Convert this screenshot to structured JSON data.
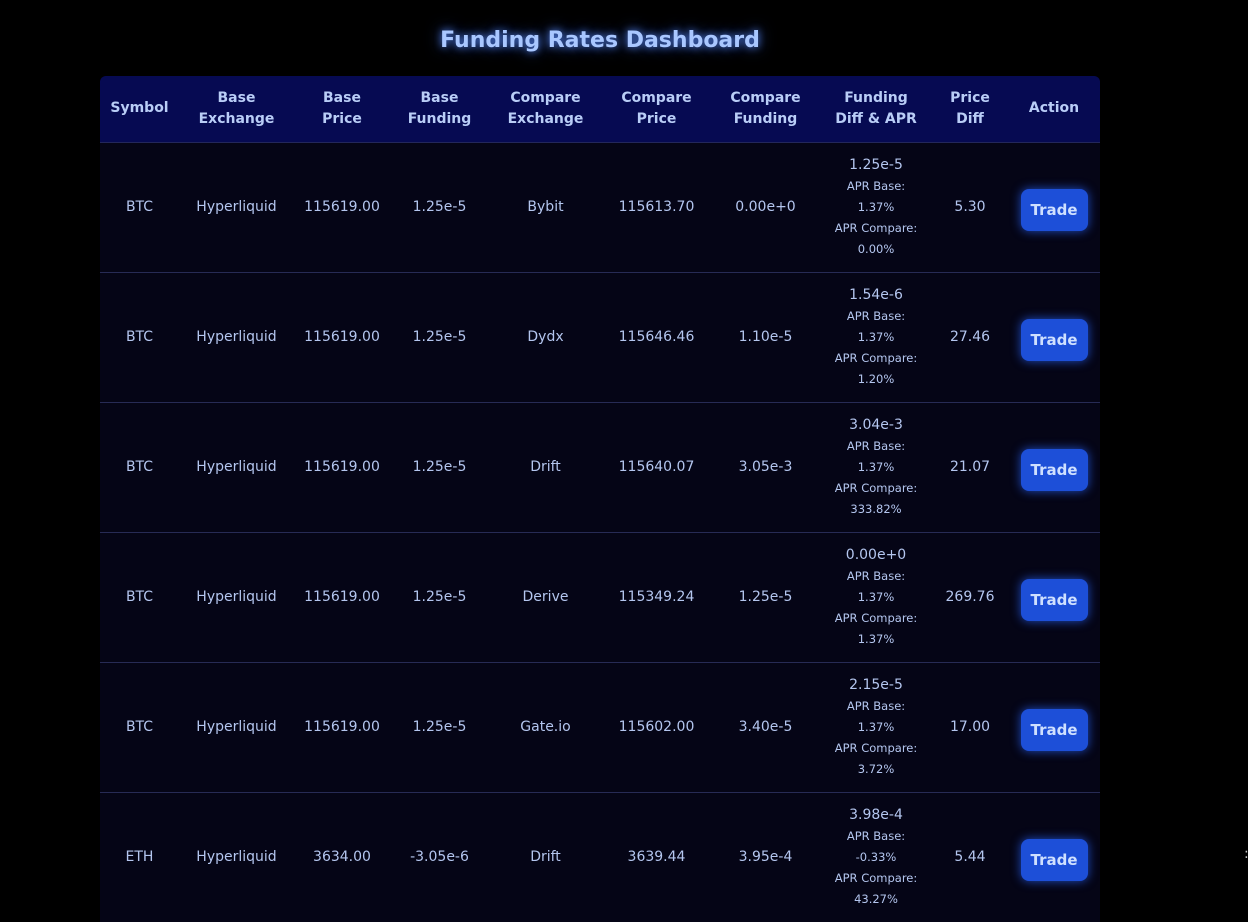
{
  "page": {
    "title": "Funding Rates Dashboard"
  },
  "table": {
    "headers": [
      {
        "line1": "Symbol",
        "line2": ""
      },
      {
        "line1": "Base",
        "line2": "Exchange"
      },
      {
        "line1": "Base",
        "line2": "Price"
      },
      {
        "line1": "Base",
        "line2": "Funding"
      },
      {
        "line1": "Compare",
        "line2": "Exchange"
      },
      {
        "line1": "Compare",
        "line2": "Price"
      },
      {
        "line1": "Compare",
        "line2": "Funding"
      },
      {
        "line1": "Funding",
        "line2": "Diff & APR"
      },
      {
        "line1": "Price",
        "line2": "Diff"
      },
      {
        "line1": "Action",
        "line2": ""
      }
    ],
    "rows": [
      {
        "symbol": "BTC",
        "base_exchange": "Hyperliquid",
        "base_price": "115619.00",
        "base_funding": "1.25e-5",
        "compare_exchange": "Bybit",
        "compare_price": "115613.70",
        "compare_funding": "0.00e+0",
        "funding_diff": "1.25e-5",
        "apr_base_label": "APR Base:",
        "apr_base": "1.37%",
        "apr_compare_label": "APR Compare:",
        "apr_compare": "0.00%",
        "price_diff": "5.30",
        "action": "Trade"
      },
      {
        "symbol": "BTC",
        "base_exchange": "Hyperliquid",
        "base_price": "115619.00",
        "base_funding": "1.25e-5",
        "compare_exchange": "Dydx",
        "compare_price": "115646.46",
        "compare_funding": "1.10e-5",
        "funding_diff": "1.54e-6",
        "apr_base_label": "APR Base:",
        "apr_base": "1.37%",
        "apr_compare_label": "APR Compare:",
        "apr_compare": "1.20%",
        "price_diff": "27.46",
        "action": "Trade"
      },
      {
        "symbol": "BTC",
        "base_exchange": "Hyperliquid",
        "base_price": "115619.00",
        "base_funding": "1.25e-5",
        "compare_exchange": "Drift",
        "compare_price": "115640.07",
        "compare_funding": "3.05e-3",
        "funding_diff": "3.04e-3",
        "apr_base_label": "APR Base:",
        "apr_base": "1.37%",
        "apr_compare_label": "APR Compare:",
        "apr_compare": "333.82%",
        "price_diff": "21.07",
        "action": "Trade"
      },
      {
        "symbol": "BTC",
        "base_exchange": "Hyperliquid",
        "base_price": "115619.00",
        "base_funding": "1.25e-5",
        "compare_exchange": "Derive",
        "compare_price": "115349.24",
        "compare_funding": "1.25e-5",
        "funding_diff": "0.00e+0",
        "apr_base_label": "APR Base:",
        "apr_base": "1.37%",
        "apr_compare_label": "APR Compare:",
        "apr_compare": "1.37%",
        "price_diff": "269.76",
        "action": "Trade"
      },
      {
        "symbol": "BTC",
        "base_exchange": "Hyperliquid",
        "base_price": "115619.00",
        "base_funding": "1.25e-5",
        "compare_exchange": "Gate.io",
        "compare_price": "115602.00",
        "compare_funding": "3.40e-5",
        "funding_diff": "2.15e-5",
        "apr_base_label": "APR Base:",
        "apr_base": "1.37%",
        "apr_compare_label": "APR Compare:",
        "apr_compare": "3.72%",
        "price_diff": "17.00",
        "action": "Trade"
      },
      {
        "symbol": "ETH",
        "base_exchange": "Hyperliquid",
        "base_price": "3634.00",
        "base_funding": "-3.05e-6",
        "compare_exchange": "Drift",
        "compare_price": "3639.44",
        "compare_funding": "3.95e-4",
        "funding_diff": "3.98e-4",
        "apr_base_label": "APR Base:",
        "apr_base": "-0.33%",
        "apr_compare_label": "APR Compare:",
        "apr_compare": "43.27%",
        "price_diff": "5.44",
        "action": "Trade"
      }
    ]
  },
  "colors": {
    "background": "#000000",
    "header_bg": "#060a52",
    "button_bg": "#1d4fd8",
    "text": "#b4c6ef",
    "title": "#a9c7ff"
  }
}
